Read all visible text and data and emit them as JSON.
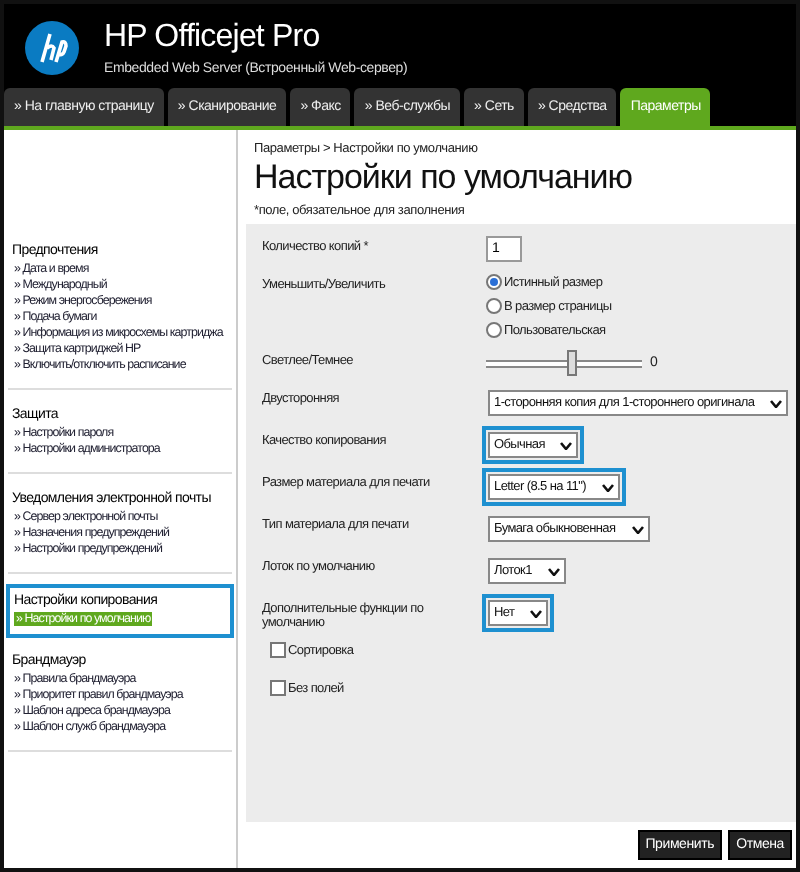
{
  "header": {
    "title": "HP Officejet Pro",
    "subtitle": "Embedded Web Server (Встроенный Web-сервер)"
  },
  "tabs": [
    {
      "label": "» На главную страницу",
      "selected": false
    },
    {
      "label": "» Сканирование",
      "selected": false
    },
    {
      "label": "» Факс",
      "selected": false
    },
    {
      "label": "» Веб-службы",
      "selected": false
    },
    {
      "label": "» Сеть",
      "selected": false
    },
    {
      "label": "» Средства",
      "selected": false
    },
    {
      "label": "Параметры",
      "selected": true
    }
  ],
  "sidebar": {
    "groups": [
      {
        "title": "Предпочтения",
        "highlighted": false,
        "items": [
          {
            "label": "» Дата и время",
            "selected": false
          },
          {
            "label": "» Международный",
            "selected": false
          },
          {
            "label": "» Режим энергосбережения",
            "selected": false
          },
          {
            "label": "» Подача бумаги",
            "selected": false
          },
          {
            "label": "» Информация из микросхемы картриджа",
            "selected": false
          },
          {
            "label": "» Защита картриджей HP",
            "selected": false
          },
          {
            "label": "» Включить/отключить расписание",
            "selected": false
          }
        ]
      },
      {
        "title": "Защита",
        "highlighted": false,
        "items": [
          {
            "label": "» Настройки пароля",
            "selected": false
          },
          {
            "label": "» Настройки администратора",
            "selected": false
          }
        ]
      },
      {
        "title": "Уведомления электронной почты",
        "highlighted": false,
        "items": [
          {
            "label": "» Сервер электронной почты",
            "selected": false
          },
          {
            "label": "» Назначения предупреждений",
            "selected": false
          },
          {
            "label": "» Настройки предупреждений",
            "selected": false
          }
        ]
      },
      {
        "title": "Настройки копирования",
        "highlighted": true,
        "items": [
          {
            "label": "» Настройки по умолчанию",
            "selected": true
          }
        ]
      },
      {
        "title": "Брандмауэр",
        "highlighted": false,
        "items": [
          {
            "label": "» Правила брандмауэра",
            "selected": false
          },
          {
            "label": "» Приоритет правил брандмауэра",
            "selected": false
          },
          {
            "label": "» Шаблон адреса брандмауэра",
            "selected": false
          },
          {
            "label": "» Шаблон служб брандмауэра",
            "selected": false
          }
        ]
      }
    ]
  },
  "breadcrumb": "Параметры > Настройки по умолчанию",
  "page_title": "Настройки по умолчанию",
  "required_note": "*поле, обязательное для заполнения",
  "form": {
    "rows": [
      {
        "kind": "text",
        "label": "Количество копий *",
        "value": "1"
      },
      {
        "kind": "radio",
        "label": "Уменьшить/Увеличить",
        "options": [
          {
            "label": "Истинный размер",
            "selected": true
          },
          {
            "label": "В размер страницы",
            "selected": false
          },
          {
            "label": "Пользовательская",
            "selected": false
          }
        ]
      },
      {
        "kind": "slider",
        "label": "Светлее/Темнее",
        "level": 0.55,
        "reading": "0"
      },
      {
        "kind": "select",
        "label": "Двусторонняя",
        "value": "1-сторонняя копия для 1-стороннего оригинала",
        "highlighted": false
      },
      {
        "kind": "select",
        "label": "Качество копирования",
        "value": "Обычная",
        "highlighted": true
      },
      {
        "kind": "select",
        "label": "Размер материала для печати",
        "value": "Letter (8.5 на 11\")",
        "highlighted": true
      },
      {
        "kind": "select",
        "label": "Тип материала для печати",
        "value": "Бумага обыкновенная",
        "highlighted": false
      },
      {
        "kind": "select",
        "label": "Лоток по умолчанию",
        "value": "Лоток1",
        "highlighted": false
      },
      {
        "kind": "select",
        "label": "Дополнительные функции по умолчанию",
        "value": "Нет",
        "highlighted": true
      },
      {
        "kind": "checkbox",
        "label": "Сортировка",
        "checked": false
      },
      {
        "kind": "checkbox",
        "label": "Без полей",
        "checked": false
      }
    ]
  },
  "buttons": [
    "Применить",
    "Отмена"
  ]
}
